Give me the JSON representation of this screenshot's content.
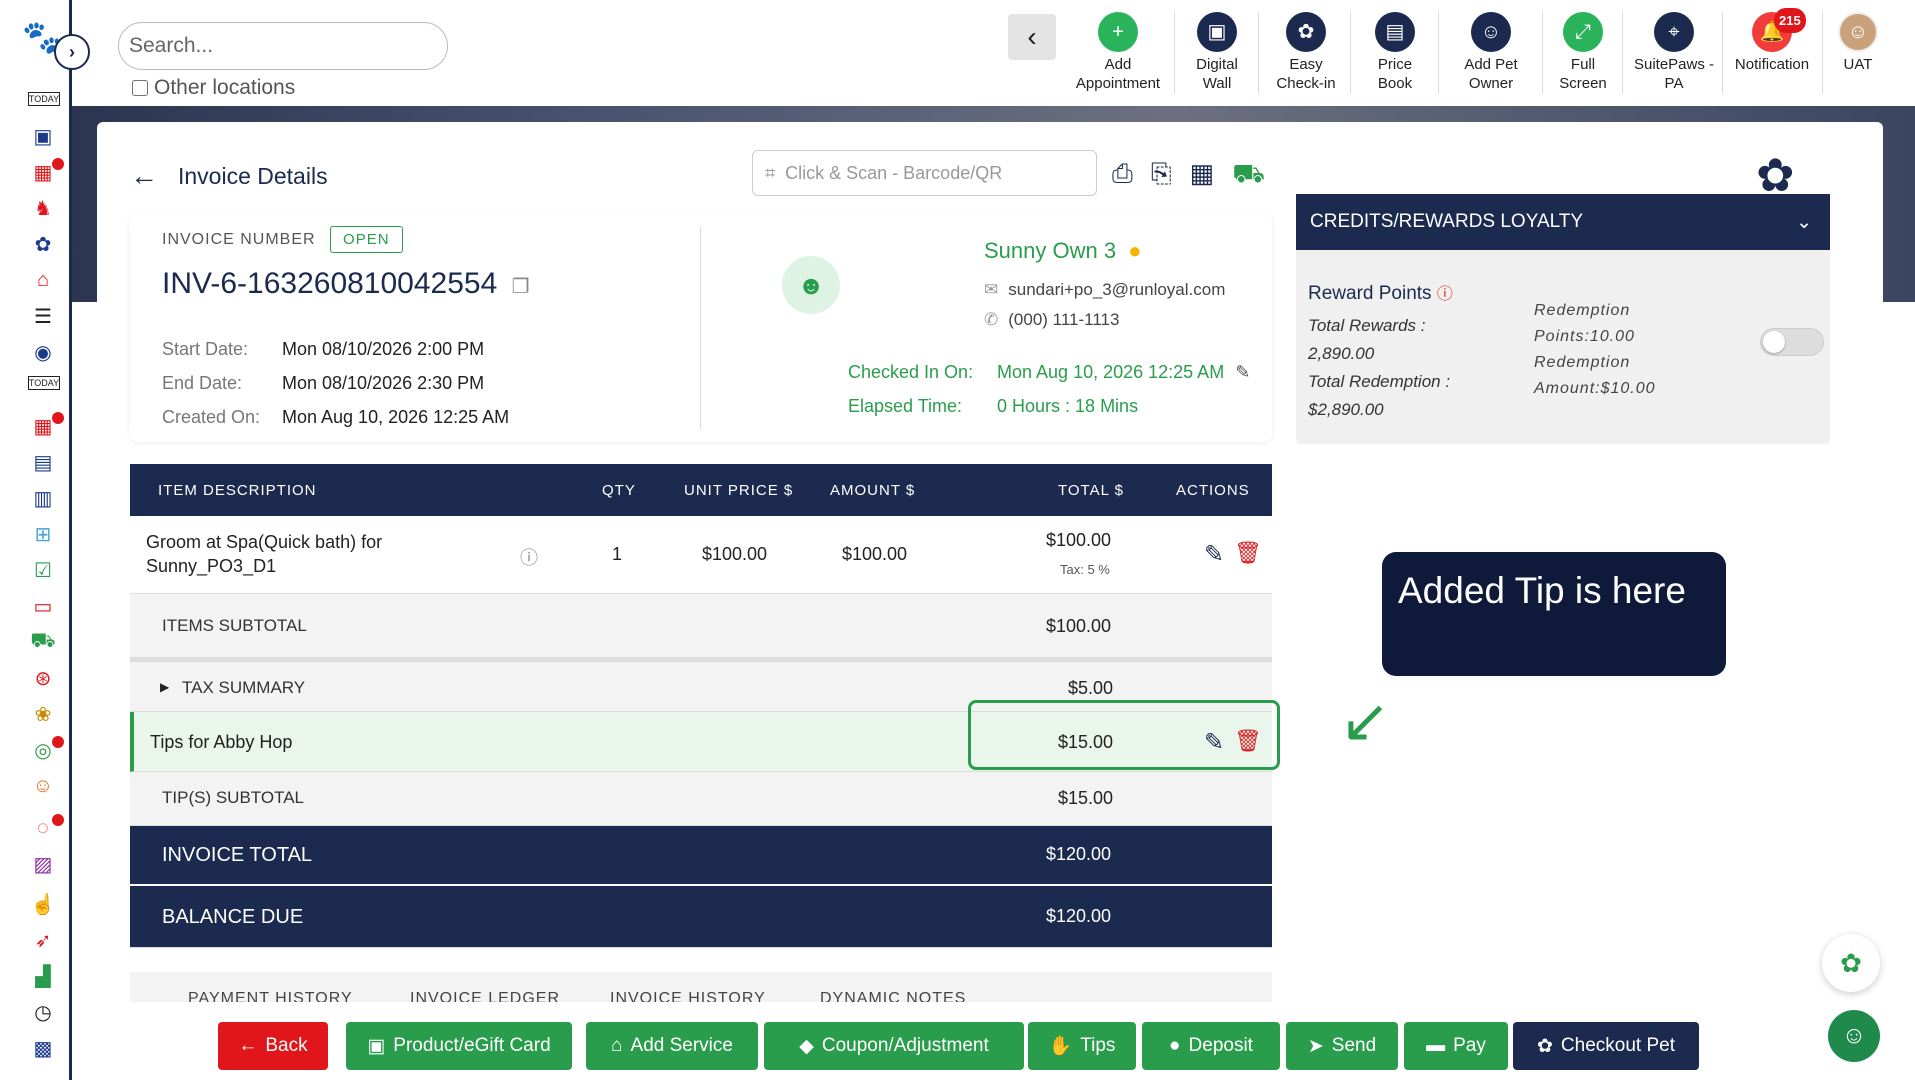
{
  "search": {
    "placeholder": "Search..."
  },
  "other_locations": "Other locations",
  "toolbar": {
    "items": [
      {
        "label": "Add Appointment",
        "icon": "calendar-add-icon"
      },
      {
        "label": "Digital Wall",
        "icon": "digital-wall-icon"
      },
      {
        "label": "Easy Check-in",
        "icon": "paw-checkin-icon"
      },
      {
        "label": "Price Book",
        "icon": "price-book-icon"
      },
      {
        "label": "Add Pet Owner",
        "icon": "add-user-icon"
      },
      {
        "label": "Full Screen",
        "icon": "fullscreen-icon"
      },
      {
        "label": "SuitePaws - PA",
        "icon": "location-pin-icon"
      },
      {
        "label": "Notification",
        "icon": "bell-icon"
      },
      {
        "label": "UAT",
        "icon": "user-avatar"
      }
    ],
    "notification_count": "215"
  },
  "invoice": {
    "header_title": "Invoice Details",
    "scan_placeholder": "Click & Scan - Barcode/QR",
    "number_label": "INVOICE NUMBER",
    "status": "OPEN",
    "number": "INV-6-163260810042554",
    "start_label": "Start Date:",
    "start": "Mon 08/10/2026 2:00 PM",
    "end_label": "End Date:",
    "end": "Mon 08/10/2026 2:30 PM",
    "created_label": "Created On:",
    "created": "Mon Aug 10, 2026 12:25 AM"
  },
  "customer": {
    "name": "Sunny Own 3",
    "email": "sundari+po_3@runloyal.com",
    "phone": "(000) 111-1113",
    "checked_in_label": "Checked In On:",
    "checked_in": "Mon Aug 10, 2026 12:25 AM",
    "elapsed_label": "Elapsed Time:",
    "elapsed": "0 Hours : 18 Mins"
  },
  "table": {
    "headers": {
      "item": "ITEM DESCRIPTION",
      "qty": "QTY",
      "unit": "UNIT PRICE $",
      "amount": "AMOUNT $",
      "total": "TOTAL $",
      "actions": "ACTIONS"
    },
    "rows": [
      {
        "description_line1": "Groom at Spa(Quick bath) for",
        "description_line2": "Sunny_PO3_D1",
        "qty": "1",
        "unit": "$100.00",
        "amount": "$100.00",
        "total": "$100.00",
        "tax": "Tax: 5 %"
      }
    ],
    "items_subtotal_label": "ITEMS SUBTOTAL",
    "items_subtotal": "$100.00",
    "tax_summary_label": "TAX SUMMARY",
    "tax_summary": "$5.00",
    "tip_label": "Tips for Abby Hop",
    "tip_amount": "$15.00",
    "tip_subtotal_label": "TIP(S) SUBTOTAL",
    "tip_subtotal": "$15.00",
    "invoice_total_label": "INVOICE TOTAL",
    "invoice_total": "$120.00",
    "balance_due_label": "BALANCE DUE",
    "balance_due": "$120.00"
  },
  "callout": "Added Tip is here",
  "tabs": [
    "PAYMENT HISTORY",
    "INVOICE LEDGER",
    "INVOICE HISTORY",
    "DYNAMIC NOTES"
  ],
  "credits": {
    "title": "CREDITS/REWARDS LOYALTY",
    "reward_points_label": "Reward Points",
    "total_rewards_label": "Total Rewards :",
    "total_rewards": "2,890.00",
    "total_redemption_label": "Total Redemption :",
    "total_redemption": "$2,890.00",
    "redemption_points_label": "Redemption",
    "redemption_points": "Points:10.00",
    "redemption_amount_label": "Redemption",
    "redemption_amount": "Amount:$10.00"
  },
  "bottom_buttons": [
    {
      "label": "Back",
      "color": "#e0161b"
    },
    {
      "label": "Product/eGift Card",
      "color": "#2a9d4c"
    },
    {
      "label": "Add Service",
      "color": "#2a9d4c"
    },
    {
      "label": "Coupon/Adjustment",
      "color": "#2a9d4c"
    },
    {
      "label": "Tips",
      "color": "#2a9d4c"
    },
    {
      "label": "Deposit",
      "color": "#2a9d4c"
    },
    {
      "label": "Send",
      "color": "#2a9d4c"
    },
    {
      "label": "Pay",
      "color": "#2a9d4c"
    },
    {
      "label": "Checkout Pet",
      "color": "#1b2a4e"
    }
  ],
  "colors": {
    "navy": "#1b2a4e",
    "green": "#2a9d4c",
    "red": "#e0161b"
  }
}
